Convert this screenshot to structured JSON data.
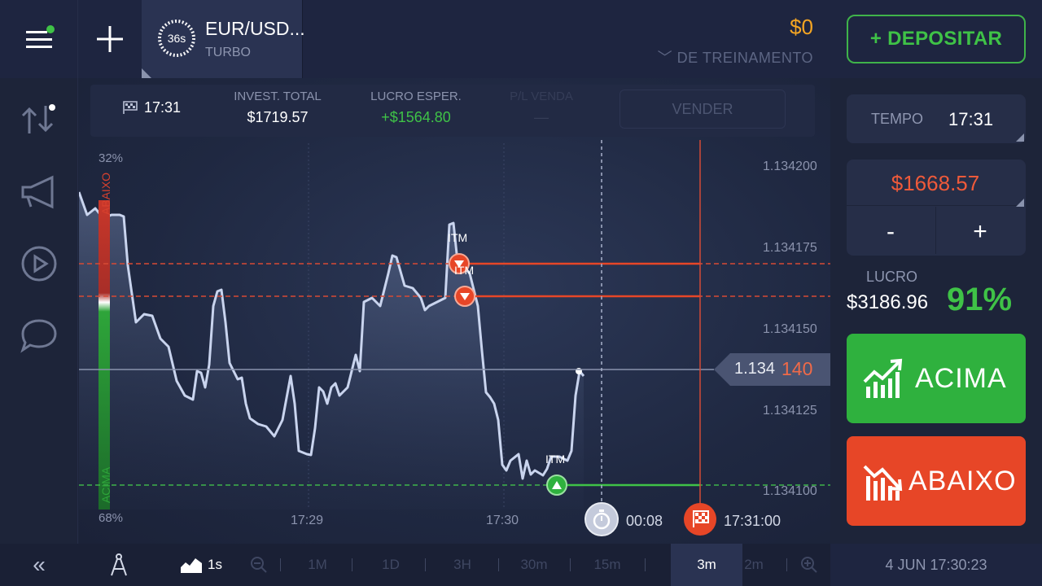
{
  "header": {
    "asset_name": "EUR/USD...",
    "asset_type": "TURBO",
    "timer": "36s",
    "balance": "$0",
    "account_type": "DE TREINAMENTO",
    "deposit_label": "+ DEPOSITAR"
  },
  "infobar": {
    "expiry_time": "17:31",
    "invest_label": "INVEST. TOTAL",
    "invest_value": "$1719.57",
    "profit_label": "LUCRO ESPER.",
    "profit_value": "+$1564.80",
    "pl_label": "P/L VENDA",
    "pl_value": "—",
    "sell_label": "VENDER"
  },
  "chart": {
    "sentiment_top_pct": "32%",
    "sentiment_bottom_pct": "68%",
    "sentiment_down_label": "ABAIXO",
    "sentiment_up_label": "ACIMA",
    "price_ticks": [
      "1.134200",
      "1.134175",
      "1.134150",
      "1.134125",
      "1.134100"
    ],
    "time_ticks": [
      "17:29",
      "17:30"
    ],
    "current_price_main": "1.134",
    "current_price_tail": "140",
    "itm_label": "ITM",
    "countdown": "00:08",
    "expiry_full": "17:31:00",
    "colors": {
      "up": "#3fc247",
      "down": "#e74627",
      "line": "#c9d4ee"
    }
  },
  "panel": {
    "tempo_label": "TEMPO",
    "tempo_value": "17:31",
    "amount": "$1668.57",
    "minus": "-",
    "plus": "+",
    "lucro_label": "LUCRO",
    "lucro_value": "$3186.96",
    "lucro_pct": "91%",
    "up_label": "ACIMA",
    "down_label": "ABAIXO"
  },
  "bottom": {
    "collapse": "«",
    "interval": "1s",
    "timeframes": [
      "1M",
      "1D",
      "3H",
      "30m",
      "15m",
      "3m",
      "2m"
    ],
    "active_timeframe": "3m",
    "datetime": "4 JUN 17:30:23"
  }
}
